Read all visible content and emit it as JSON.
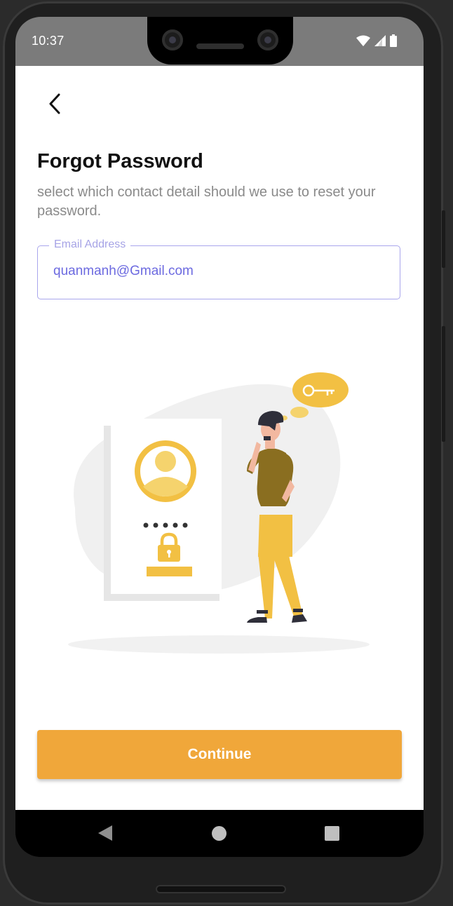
{
  "status_bar": {
    "time": "10:37",
    "icons": [
      "wifi-icon",
      "signal-icon",
      "battery-icon"
    ]
  },
  "header": {
    "back_icon": "chevron-left-icon",
    "title": "Forgot Password",
    "subtitle": "select which contact detail should we use to reset your password."
  },
  "form": {
    "email": {
      "label": "Email Address",
      "value": "quanmanh@Gmail.com"
    }
  },
  "illustration": {
    "name": "person-thinking-about-key-with-locked-profile-card",
    "icons": [
      "profile-avatar-icon",
      "padlock-icon",
      "key-icon"
    ]
  },
  "actions": {
    "continue_label": "Continue"
  },
  "nav_bar": {
    "buttons": [
      "back-triangle-icon",
      "home-circle-icon",
      "recents-square-icon"
    ]
  },
  "colors": {
    "accent": "#f0a73a",
    "field_border": "#a9a6ec",
    "field_text": "#6c6ae0",
    "status_bar": "#7b7b7b",
    "illustration_yellow": "#f2c043",
    "shirt": "#8a6e20"
  }
}
